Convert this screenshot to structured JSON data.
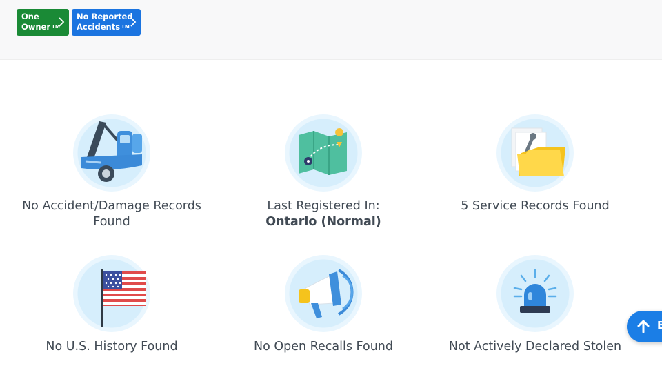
{
  "header": {
    "badges": [
      {
        "line1": "One",
        "line2": "Owner",
        "tm": "TM",
        "color": "#1a8a36"
      },
      {
        "line1": "No Reported",
        "line2": "Accidents",
        "tm": "TM",
        "color": "#1b74e0"
      }
    ]
  },
  "history_items": [
    {
      "icon": "tow-truck-icon",
      "label": "No Accident/Damage Records Found"
    },
    {
      "icon": "map-icon",
      "label": "Last Registered In:",
      "value": "Ontario (Normal)"
    },
    {
      "icon": "service-folder-icon",
      "label": "5 Service Records Found"
    },
    {
      "icon": "us-flag-icon",
      "label": "No U.S. History Found"
    },
    {
      "icon": "megaphone-icon",
      "label": "No Open Recalls Found"
    },
    {
      "icon": "siren-icon",
      "label": "Not Actively Declared Stolen"
    }
  ],
  "back_to_top": {
    "label": "B",
    "icon": "arrow-up-icon"
  }
}
